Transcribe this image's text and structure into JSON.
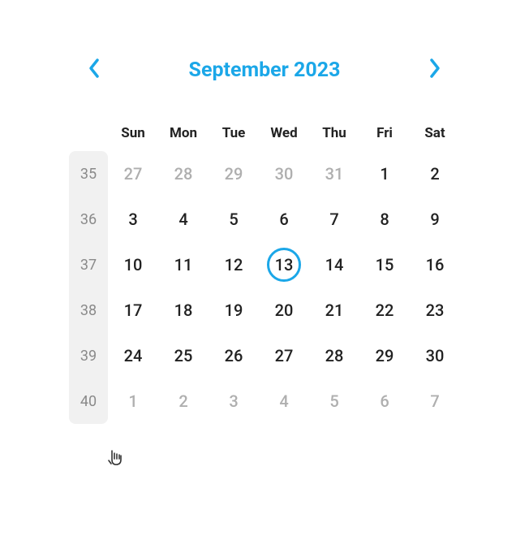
{
  "header": {
    "title": "September 2023"
  },
  "dow": [
    "Sun",
    "Mon",
    "Tue",
    "Wed",
    "Thu",
    "Fri",
    "Sat"
  ],
  "weeks": [
    {
      "num": "35",
      "days": [
        {
          "d": "27",
          "other": true
        },
        {
          "d": "28",
          "other": true
        },
        {
          "d": "29",
          "other": true
        },
        {
          "d": "30",
          "other": true
        },
        {
          "d": "31",
          "other": true
        },
        {
          "d": "1",
          "other": false
        },
        {
          "d": "2",
          "other": false
        }
      ]
    },
    {
      "num": "36",
      "days": [
        {
          "d": "3",
          "other": false
        },
        {
          "d": "4",
          "other": false
        },
        {
          "d": "5",
          "other": false
        },
        {
          "d": "6",
          "other": false
        },
        {
          "d": "7",
          "other": false
        },
        {
          "d": "8",
          "other": false
        },
        {
          "d": "9",
          "other": false
        }
      ]
    },
    {
      "num": "37",
      "days": [
        {
          "d": "10",
          "other": false
        },
        {
          "d": "11",
          "other": false
        },
        {
          "d": "12",
          "other": false
        },
        {
          "d": "13",
          "other": false,
          "today": true
        },
        {
          "d": "14",
          "other": false
        },
        {
          "d": "15",
          "other": false
        },
        {
          "d": "16",
          "other": false
        }
      ]
    },
    {
      "num": "38",
      "days": [
        {
          "d": "17",
          "other": false
        },
        {
          "d": "18",
          "other": false
        },
        {
          "d": "19",
          "other": false
        },
        {
          "d": "20",
          "other": false
        },
        {
          "d": "21",
          "other": false
        },
        {
          "d": "22",
          "other": false
        },
        {
          "d": "23",
          "other": false
        }
      ]
    },
    {
      "num": "39",
      "days": [
        {
          "d": "24",
          "other": false
        },
        {
          "d": "25",
          "other": false
        },
        {
          "d": "26",
          "other": false
        },
        {
          "d": "27",
          "other": false
        },
        {
          "d": "28",
          "other": false
        },
        {
          "d": "29",
          "other": false
        },
        {
          "d": "30",
          "other": false
        }
      ]
    },
    {
      "num": "40",
      "days": [
        {
          "d": "1",
          "other": true
        },
        {
          "d": "2",
          "other": true
        },
        {
          "d": "3",
          "other": true
        },
        {
          "d": "4",
          "other": true
        },
        {
          "d": "5",
          "other": true
        },
        {
          "d": "6",
          "other": true
        },
        {
          "d": "7",
          "other": true
        }
      ]
    }
  ]
}
